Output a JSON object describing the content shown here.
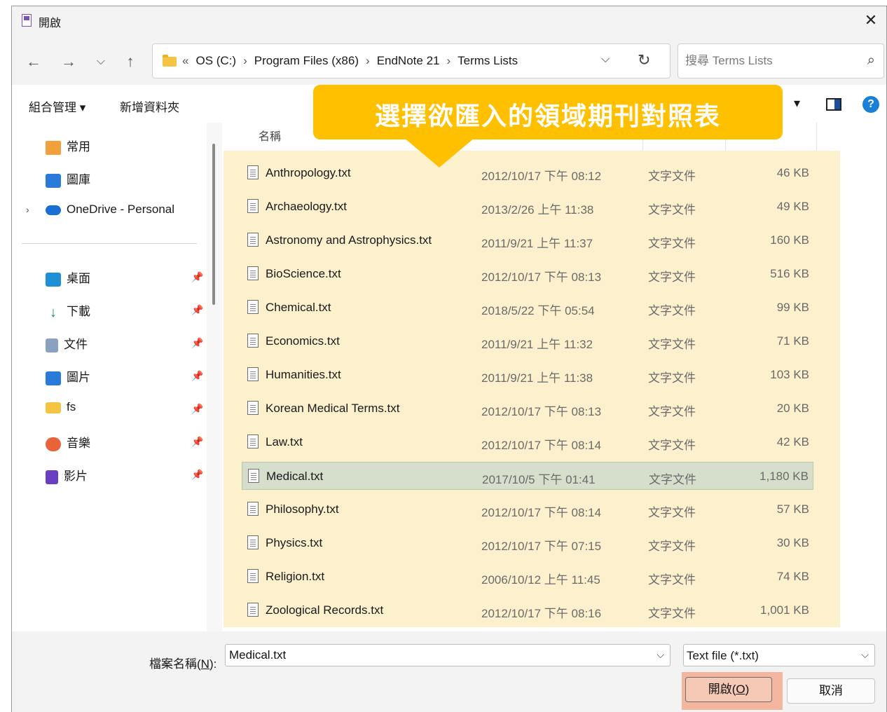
{
  "window": {
    "title": "開啟"
  },
  "nav": {
    "back_icon": "←",
    "forward_icon": "→",
    "recent_icon": "⌵",
    "up_icon": "↑",
    "breadcrumb": [
      "«",
      "OS (C:)",
      "›",
      "Program Files (x86)",
      "›",
      "EndNote 21",
      "›",
      "Terms Lists"
    ],
    "search_placeholder": "搜尋 Terms Lists"
  },
  "toolbar": {
    "organize_label": "組合管理 ▾",
    "new_folder_label": "新增資料夾",
    "view_dropdown": "▾"
  },
  "sidebar": {
    "quick": [
      {
        "label": "常用",
        "icon": "home-icon"
      },
      {
        "label": "圖庫",
        "icon": "gallery-icon"
      },
      {
        "label": "OneDrive - Personal",
        "icon": "cloud-icon"
      }
    ],
    "pinned": [
      {
        "label": "桌面",
        "icon": "desktop-icon"
      },
      {
        "label": "下載",
        "icon": "download-icon"
      },
      {
        "label": "文件",
        "icon": "document-icon"
      },
      {
        "label": "圖片",
        "icon": "pictures-icon"
      },
      {
        "label": "fs",
        "icon": "folder-icon"
      },
      {
        "label": "音樂",
        "icon": "music-icon"
      },
      {
        "label": "影片",
        "icon": "video-icon"
      }
    ]
  },
  "list": {
    "column_name": "名稱",
    "files": [
      {
        "name": "Anthropology.txt",
        "date": "2012/10/17 下午 08:12",
        "type": "文字文件",
        "size": "46 KB"
      },
      {
        "name": "Archaeology.txt",
        "date": "2013/2/26 上午 11:38",
        "type": "文字文件",
        "size": "49 KB"
      },
      {
        "name": "Astronomy and Astrophysics.txt",
        "date": "2011/9/21 上午 11:37",
        "type": "文字文件",
        "size": "160 KB"
      },
      {
        "name": "BioScience.txt",
        "date": "2012/10/17 下午 08:13",
        "type": "文字文件",
        "size": "516 KB"
      },
      {
        "name": "Chemical.txt",
        "date": "2018/5/22 下午 05:54",
        "type": "文字文件",
        "size": "99 KB"
      },
      {
        "name": "Economics.txt",
        "date": "2011/9/21 上午 11:32",
        "type": "文字文件",
        "size": "71 KB"
      },
      {
        "name": "Humanities.txt",
        "date": "2011/9/21 上午 11:38",
        "type": "文字文件",
        "size": "103 KB"
      },
      {
        "name": "Korean Medical Terms.txt",
        "date": "2012/10/17 下午 08:13",
        "type": "文字文件",
        "size": "20 KB"
      },
      {
        "name": "Law.txt",
        "date": "2012/10/17 下午 08:14",
        "type": "文字文件",
        "size": "42 KB"
      },
      {
        "name": "Medical.txt",
        "date": "2017/10/5 下午 01:41",
        "type": "文字文件",
        "size": "1,180 KB"
      },
      {
        "name": "Philosophy.txt",
        "date": "2012/10/17 下午 08:14",
        "type": "文字文件",
        "size": "57 KB"
      },
      {
        "name": "Physics.txt",
        "date": "2012/10/17 下午 07:15",
        "type": "文字文件",
        "size": "30 KB"
      },
      {
        "name": "Religion.txt",
        "date": "2006/10/12 上午 11:45",
        "type": "文字文件",
        "size": "74 KB"
      },
      {
        "name": "Zoological Records.txt",
        "date": "2012/10/17 下午 08:16",
        "type": "文字文件",
        "size": "1,001 KB"
      }
    ]
  },
  "callout": {
    "text": "選擇欲匯入的領域期刊對照表"
  },
  "footer": {
    "filename_label_prefix": "檔案名稱(",
    "filename_label_key": "N",
    "filename_label_suffix": "):",
    "filename_value": "Medical.txt",
    "filetype_value": "Text file  (*.txt)",
    "open_prefix": "開啟(",
    "open_key": "O",
    "open_suffix": ")",
    "cancel_label": "取消"
  },
  "colors": {
    "callout": "#ffc000",
    "highlight": "#fdf0cc",
    "selected_row": "#d6dfcb",
    "open_button_highlight": "#f4b69e"
  }
}
